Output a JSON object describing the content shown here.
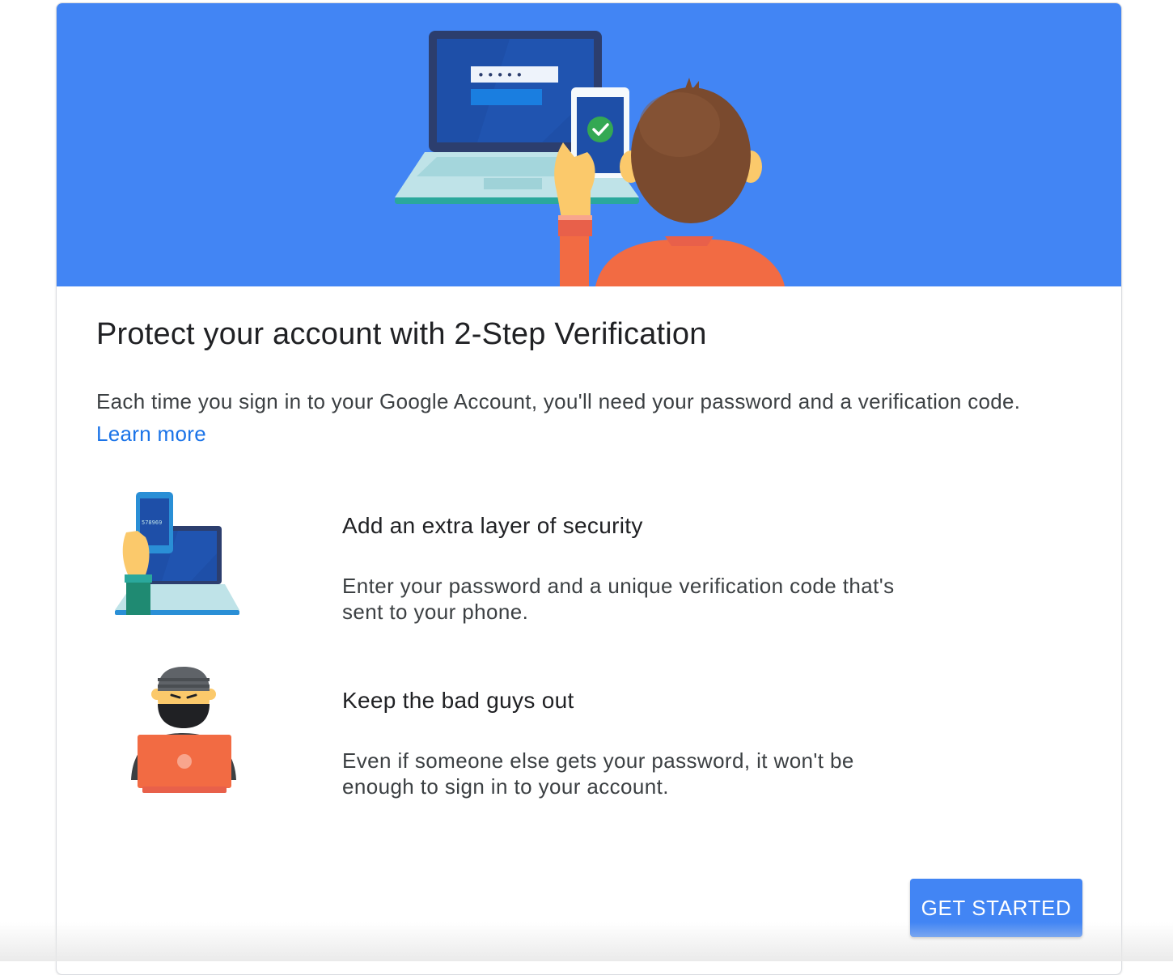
{
  "hero": {
    "illustration": "person-laptop-phone-verification-illustration",
    "password_mask": "•••••"
  },
  "main": {
    "title": "Protect your account with 2-Step Verification",
    "intro_text": "Each time you sign in to your Google Account, you'll need your password and a verification code.",
    "learn_more_label": "Learn more"
  },
  "features": [
    {
      "icon": "phone-laptop-code-icon",
      "code_on_phone": "578969",
      "title": "Add an extra layer of security",
      "description": "Enter your password and a unique verification code that's sent to your phone."
    },
    {
      "icon": "burglar-laptop-icon",
      "title": "Keep the bad guys out",
      "description": "Even if someone else gets your password, it won't be enough to sign in to your account."
    }
  ],
  "actions": {
    "get_started_label": "GET STARTED"
  },
  "colors": {
    "hero_blue": "#4285f4",
    "link_blue": "#1a73e8",
    "button_blue": "#4285f4",
    "title_text": "#202124",
    "body_text": "#3c4043"
  }
}
